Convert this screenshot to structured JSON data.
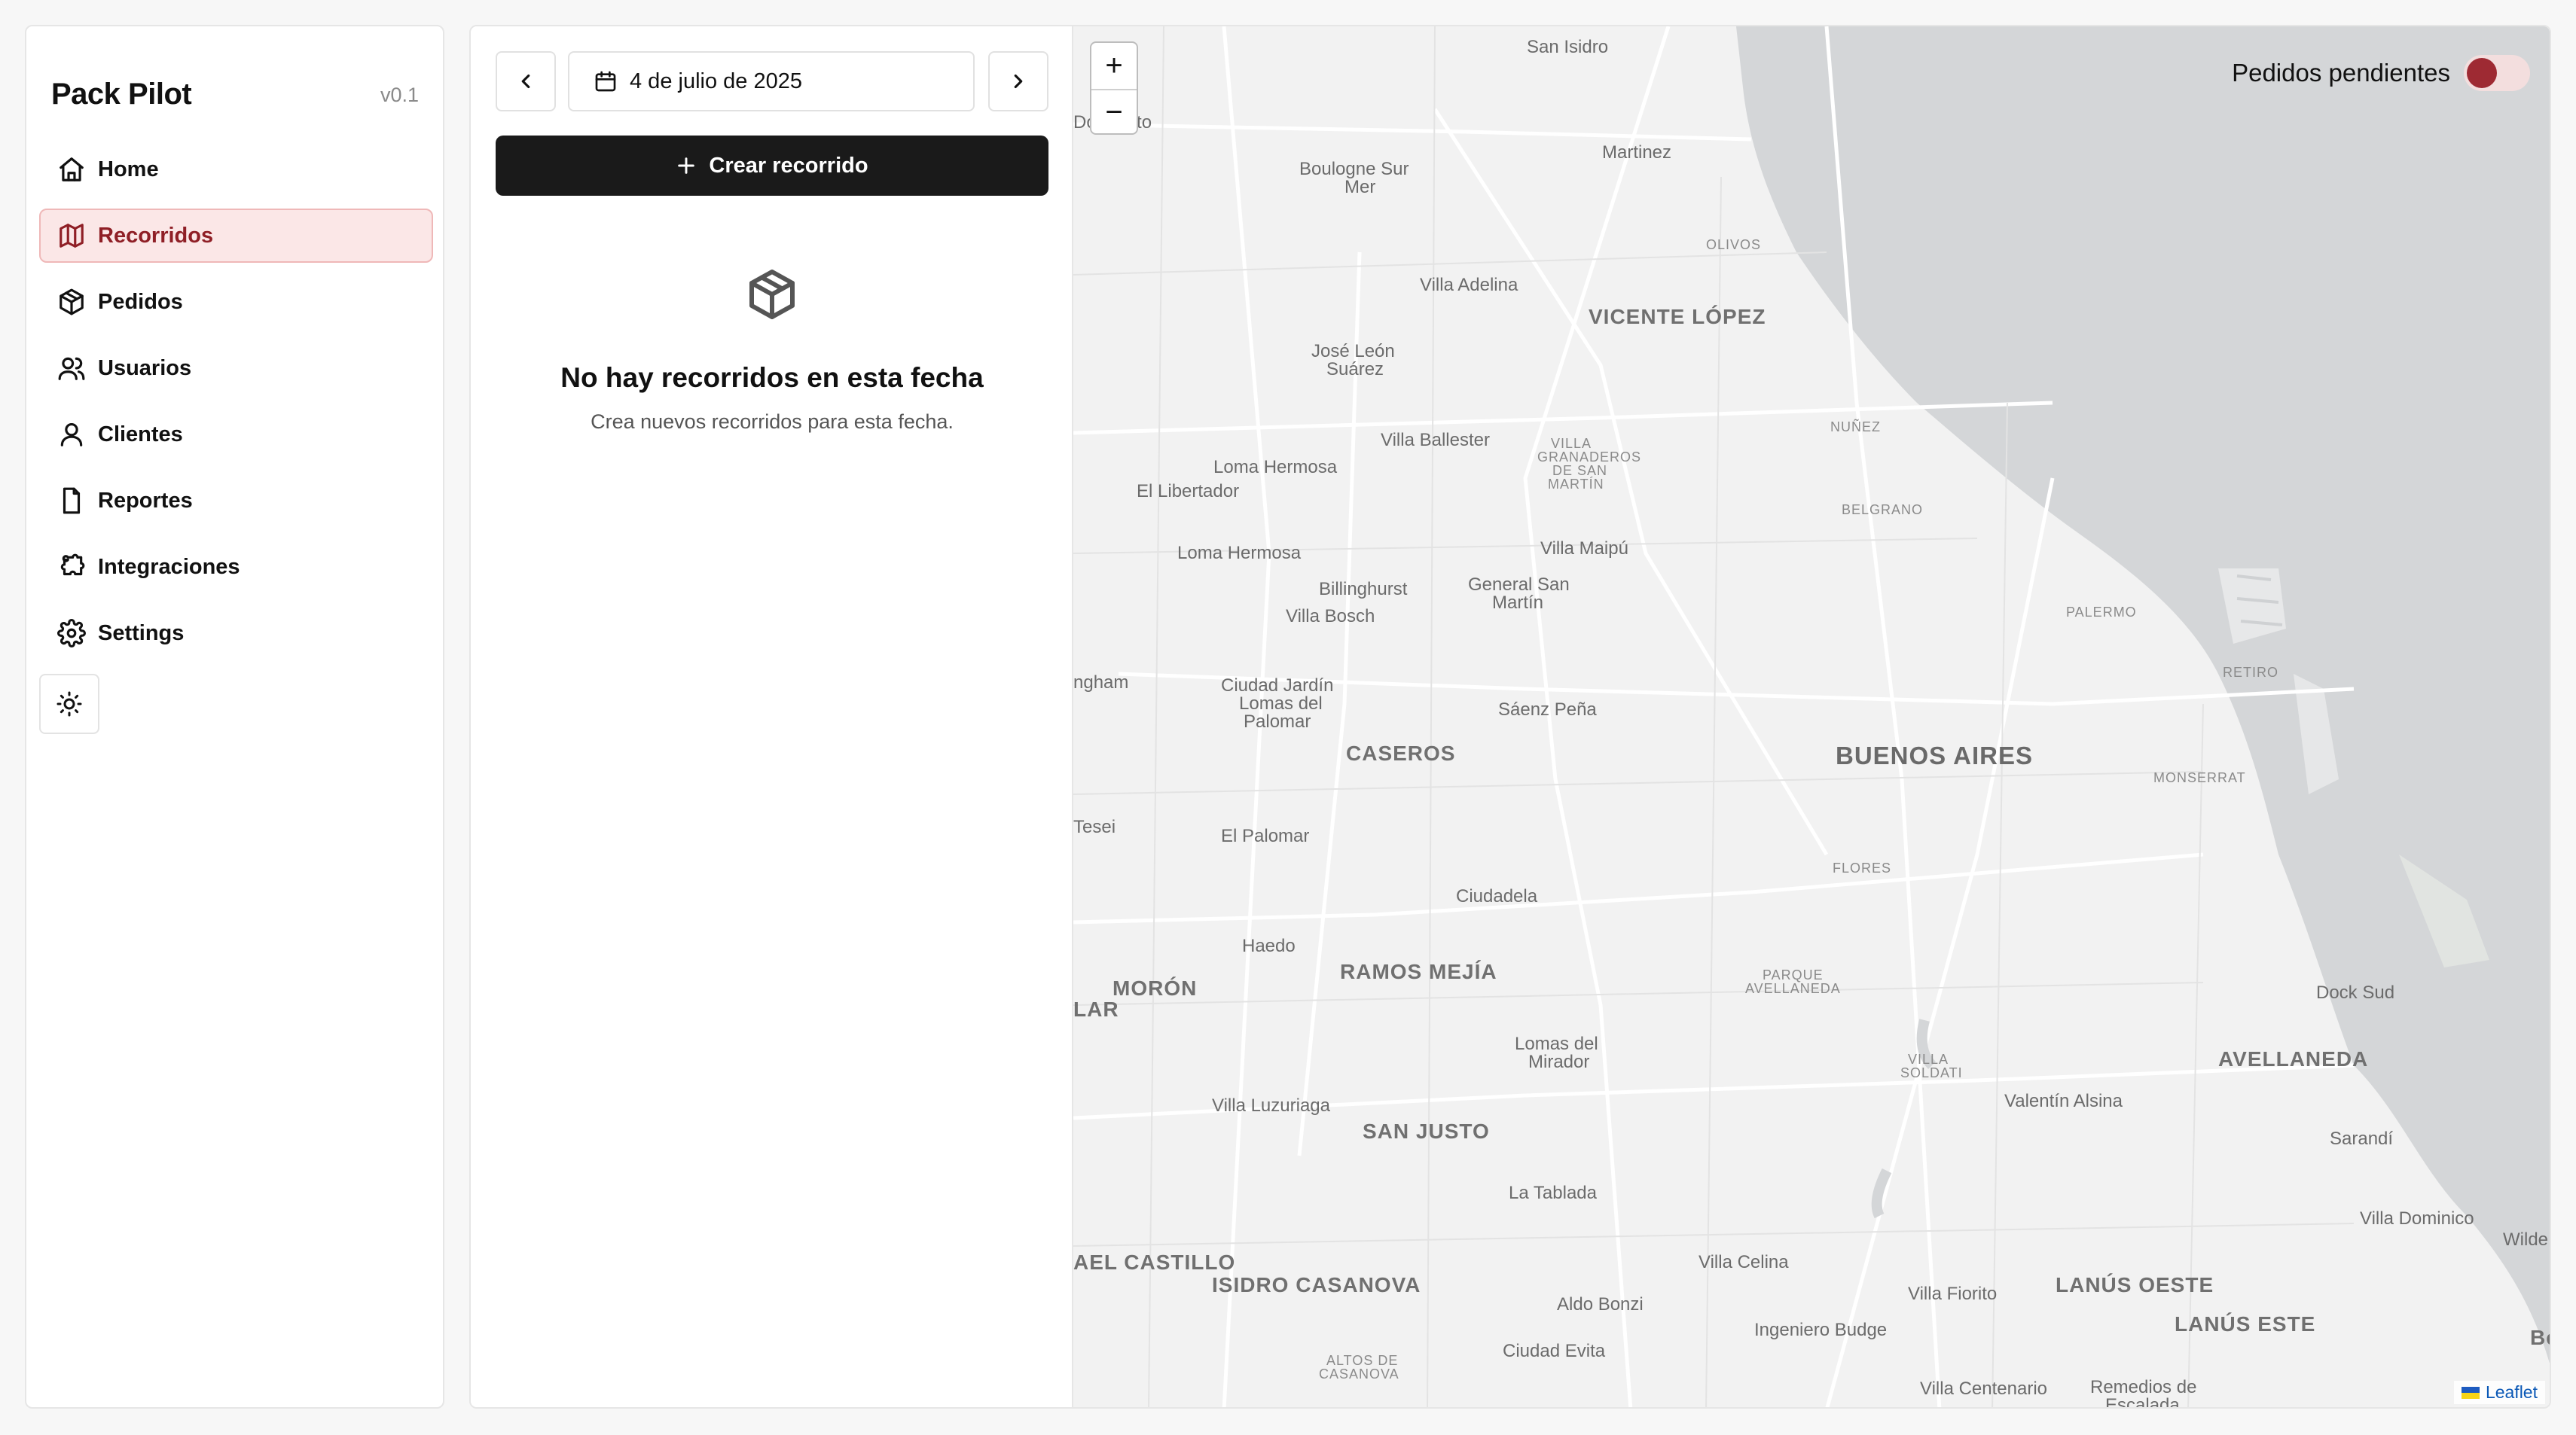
{
  "app": {
    "name": "Pack Pilot",
    "version": "v0.1"
  },
  "sidebar": {
    "items": [
      {
        "label": "Home",
        "icon": "home-icon"
      },
      {
        "label": "Recorridos",
        "icon": "map-icon",
        "active": true
      },
      {
        "label": "Pedidos",
        "icon": "package-icon"
      },
      {
        "label": "Usuarios",
        "icon": "users-icon"
      },
      {
        "label": "Clientes",
        "icon": "user-icon"
      },
      {
        "label": "Reportes",
        "icon": "file-icon"
      },
      {
        "label": "Integraciones",
        "icon": "puzzle-icon"
      },
      {
        "label": "Settings",
        "icon": "gear-icon"
      }
    ],
    "theme_toggle_icon": "sun-icon"
  },
  "routes_panel": {
    "date": "4 de julio de 2025",
    "create_label": "Crear recorrido",
    "empty_title": "No hay recorridos en esta fecha",
    "empty_description": "Crea nuevos recorridos para esta fecha."
  },
  "map": {
    "zoom_in": "+",
    "zoom_out": "−",
    "pending_toggle_label": "Pedidos pendientes",
    "pending_toggle_on": false,
    "attribution": "Leaflet",
    "labels": {
      "san_isidro": "San Isidro",
      "carcuato": "Do   rcuato",
      "martinez": "Martinez",
      "boulogne": "Boulogne Sur",
      "boulogne2": "Mer",
      "olivos": "OLIVOS",
      "villa_adelina": "Villa Adelina",
      "vicente_lopez": "VICENTE LÓPEZ",
      "jose_leon": "José León",
      "jose_leon2": "Suárez",
      "nunez": "NUÑEZ",
      "villa_ballester": "Villa Ballester",
      "granaderos": "VILLA",
      "granaderos2": "GRANADEROS",
      "granaderos3": "DE SAN",
      "granaderos4": "MARTÍN",
      "loma_hermosa1": "Loma Hermosa",
      "el_libertador": "El Libertador",
      "belgrano": "BELGRANO",
      "loma_hermosa2": "Loma Hermosa",
      "villa_maipu": "Villa Maipú",
      "billinghurst": "Billinghurst",
      "general_san_martin": "General San",
      "general_san_martin2": "Martín",
      "villa_bosch": "Villa Bosch",
      "palermo": "PALERMO",
      "hurlingham": "ngham",
      "ciudad_jardin": "Ciudad Jardín",
      "ciudad_jardin2": "Lomas del",
      "ciudad_jardin3": "Palomar",
      "saenz_pena": "Sáenz Peña",
      "retiro": "RETIRO",
      "caseros": "CASEROS",
      "buenos_aires": "BUENOS AIRES",
      "monserrat": "MONSERRAT",
      "tesei": "Tesei",
      "el_palomar": "El Palomar",
      "flores": "FLORES",
      "ciudadela": "Ciudadela",
      "haedo": "Haedo",
      "ramos_mejia": "RAMOS MEJÍA",
      "parque_avellaneda": "PARQUE",
      "parque_avellaneda2": "AVELLANEDA",
      "moron": "MORÓN",
      "lar": "LAR",
      "dock_sud": "Dock Sud",
      "lomas_del_mirador": "Lomas del",
      "lomas_del_mirador2": "Mirador",
      "avellaneda": "AVELLANEDA",
      "villa_soldati": "VILLA",
      "villa_soldati2": "SOLDATI",
      "valentin_alsina": "Valentín Alsina",
      "villa_luzuriaga": "Villa Luzuriaga",
      "san_justo": "SAN JUSTO",
      "sarandi": "Sarandí",
      "la_tablada": "La Tablada",
      "villa_dominico": "Villa Dominico",
      "wilde": "Wilde",
      "el_castillo": "AEL CASTILLO",
      "isidro_casanova": "ISIDRO CASANOVA",
      "villa_celina": "Villa Celina",
      "lanus_oeste": "LANÚS OESTE",
      "villa_fiorito": "Villa Fiorito",
      "aldo_bonzi": "Aldo Bonzi",
      "lanus_este": "LANÚS ESTE",
      "ingeniero_budge": "Ingeniero Budge",
      "altos_casanova": "ALTOS DE",
      "altos_casanova2": "CASANOVA",
      "ciudad_evita": "Ciudad Evita",
      "villa_centenario": "Villa Centenario",
      "remedios": "Remedios de",
      "remedios2": "Escalada",
      "bernal_edge": "Be"
    }
  },
  "colors": {
    "accent": "#9e2a33",
    "active_bg": "#fbe7e7",
    "primary_button": "#1a1a1a",
    "water": "#d4d6d8",
    "land": "#f2f2f2"
  }
}
